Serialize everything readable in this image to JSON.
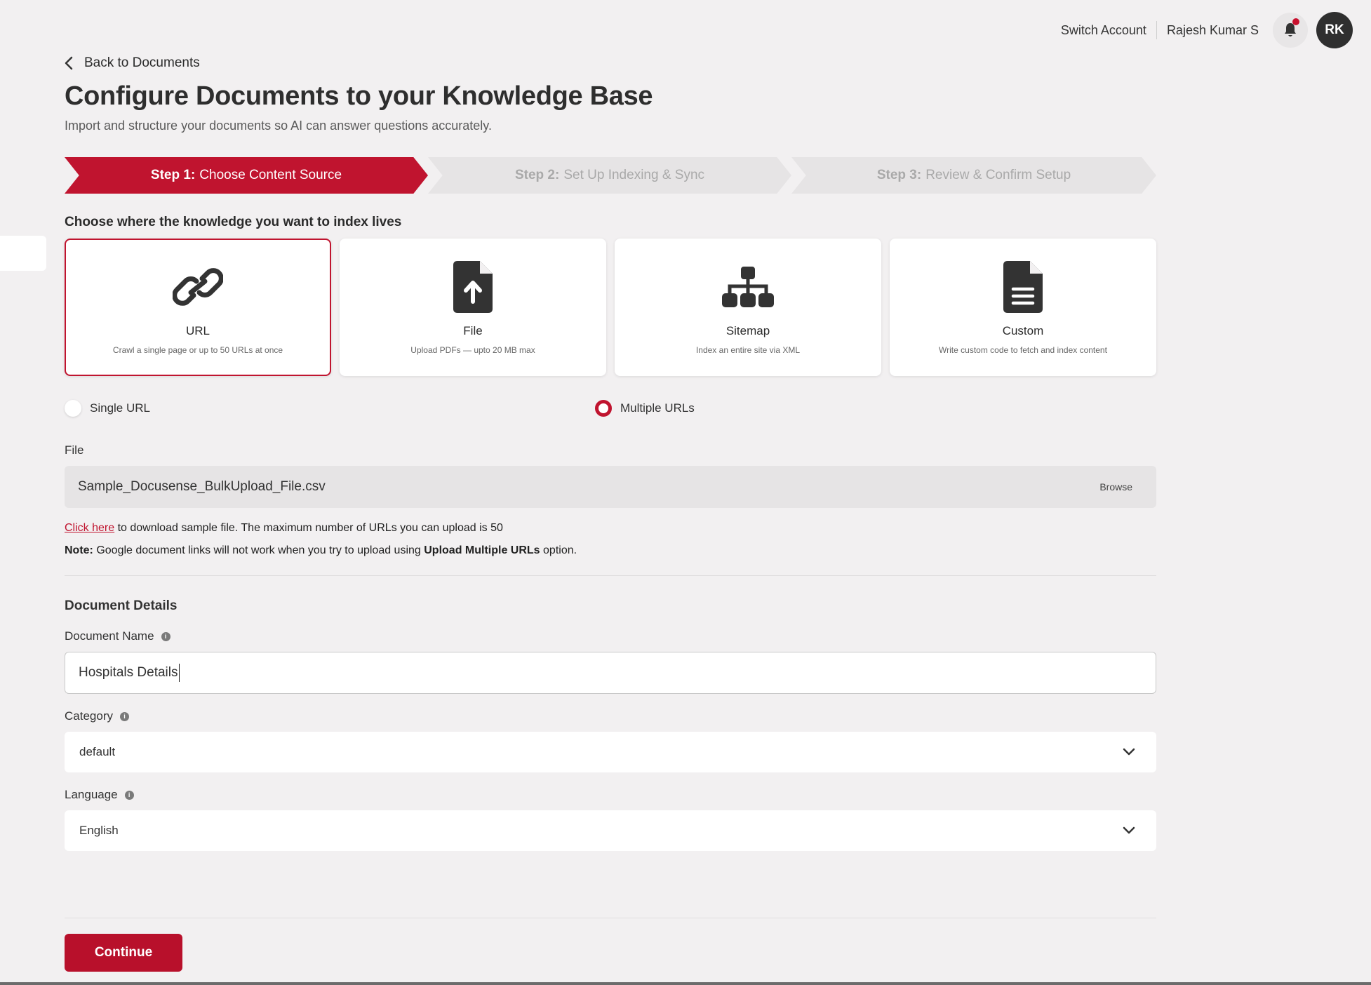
{
  "topbar": {
    "switch_account": "Switch Account",
    "user_name": "Rajesh Kumar S",
    "avatar_initials": "RK"
  },
  "header": {
    "back_label": "Back to Documents",
    "title": "Configure Documents to your Knowledge Base",
    "subtitle": "Import and structure your documents so AI can answer questions accurately."
  },
  "stepper": {
    "steps": [
      {
        "prefix": "Step 1:",
        "label": "Choose Content Source",
        "state": "active"
      },
      {
        "prefix": "Step 2:",
        "label": "Set Up Indexing & Sync",
        "state": "inactive"
      },
      {
        "prefix": "Step 3:",
        "label": "Review & Confirm Setup",
        "state": "inactive"
      }
    ]
  },
  "source": {
    "heading": "Choose where the knowledge you want to index lives",
    "cards": [
      {
        "title": "URL",
        "desc": "Crawl a single page or up to 50 URLs at once",
        "icon": "link-icon",
        "selected": true
      },
      {
        "title": "File",
        "desc": "Upload PDFs — upto 20 MB max",
        "icon": "file-upload-icon",
        "selected": false
      },
      {
        "title": "Sitemap",
        "desc": "Index an entire site via XML",
        "icon": "sitemap-icon",
        "selected": false
      },
      {
        "title": "Custom",
        "desc": "Write custom code to fetch and index content",
        "icon": "document-icon",
        "selected": false
      }
    ]
  },
  "url_mode": {
    "options": [
      {
        "label": "Single URL",
        "selected": false
      },
      {
        "label": "Multiple URLs",
        "selected": true
      }
    ]
  },
  "file": {
    "label": "File",
    "value": "Sample_Docusense_BulkUpload_File.csv",
    "browse_label": "Browse",
    "hint_link": "Click here",
    "hint_text": " to download sample file. The maximum number of URLs you can upload is 50",
    "note_prefix": "Note:",
    "note_text": " Google document links will not work when you try to upload using ",
    "note_bold": "Upload Multiple URLs",
    "note_suffix": " option."
  },
  "details": {
    "heading": "Document Details",
    "name_label": "Document Name",
    "name_value": "Hospitals Details",
    "category_label": "Category",
    "category_value": "default",
    "language_label": "Language",
    "language_value": "English"
  },
  "actions": {
    "continue_label": "Continue"
  },
  "colors": {
    "accent": "#c0142f",
    "background": "#f2f0f1"
  }
}
